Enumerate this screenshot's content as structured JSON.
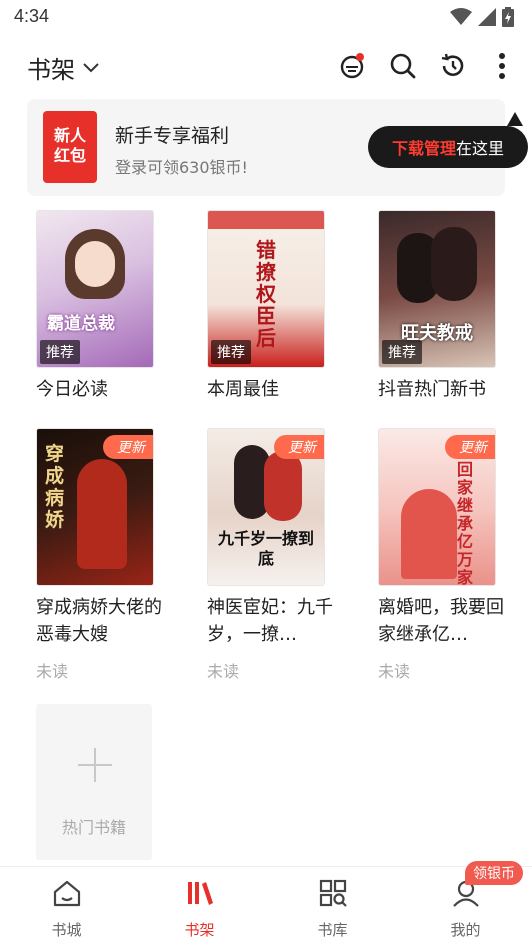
{
  "status_bar": {
    "time": "4:34"
  },
  "header": {
    "title": "书架"
  },
  "promo": {
    "badge_line1": "新人",
    "badge_line2": "红包",
    "title": "新手专享福利",
    "subtitle": "登录可领630银币!"
  },
  "tooltip": {
    "highlight": "下载管理",
    "text": "在这里"
  },
  "books": [
    {
      "title": "今日必读",
      "badge": "推荐",
      "cover_text": "霸道总裁",
      "status": ""
    },
    {
      "title": "本周最佳",
      "badge": "推荐",
      "cover_text": "错撩权臣后",
      "status": ""
    },
    {
      "title": "抖音热门新书",
      "badge": "推荐",
      "cover_text": "旺夫教戒",
      "status": ""
    },
    {
      "title": "穿成病娇大佬的恶毒大嫂",
      "badge": "更新",
      "cover_text": "穿成病娇",
      "status": "未读"
    },
    {
      "title": "神医宦妃：九千岁，一撩…",
      "badge": "更新",
      "cover_text": "九千岁一撩到底",
      "status": "未读"
    },
    {
      "title": "离婚吧，我要回家继承亿…",
      "badge": "更新",
      "cover_text": "回家继承亿万家产",
      "status": "未读"
    }
  ],
  "add_tile": {
    "label": "热门书籍"
  },
  "tabbar": {
    "items": [
      {
        "label": "书城",
        "icon": "home-icon"
      },
      {
        "label": "书架",
        "icon": "bookshelf-icon"
      },
      {
        "label": "书库",
        "icon": "library-grid-icon"
      },
      {
        "label": "我的",
        "icon": "profile-icon"
      }
    ],
    "active_index": 1,
    "bubble": "领银币"
  },
  "colors": {
    "accent": "#e8302a",
    "badge_update": "#ff6a4d"
  }
}
